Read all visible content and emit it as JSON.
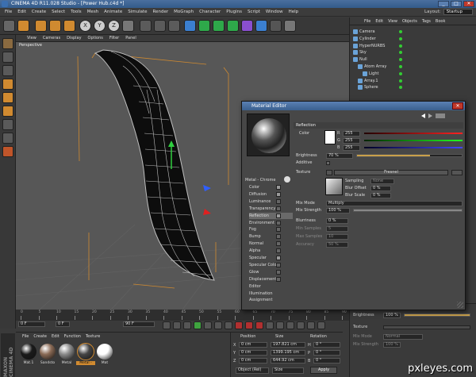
{
  "app": {
    "title": "CINEMA 4D R11.028 Studio - [Power Hub.c4d *]"
  },
  "menu": [
    "File",
    "Edit",
    "Create",
    "Select",
    "Tools",
    "Mesh",
    "Animate",
    "Simulate",
    "Render",
    "MoGraph",
    "Character",
    "Plugins",
    "Script",
    "Window",
    "Help"
  ],
  "layout": {
    "label": "Layout:",
    "value": "Startup"
  },
  "toolbar": {
    "icons": [
      "undo-icon",
      "select-icon",
      "move-icon",
      "scale-icon",
      "rotate-icon",
      "x-axis-icon",
      "y-axis-icon",
      "z-axis-icon",
      "coord-icon",
      "render-view-icon",
      "render-icon",
      "render-settings-icon",
      "cube-icon",
      "pen-icon",
      "subdivision-icon",
      "array-icon",
      "deformer-icon",
      "scene-icon",
      "camera-icon",
      "light-icon"
    ],
    "axes": [
      "X",
      "Y",
      "Z"
    ]
  },
  "viewport": {
    "menu": [
      "View",
      "Cameras",
      "Display",
      "Options",
      "Filter",
      "Panel"
    ],
    "label": "Perspective"
  },
  "objects": {
    "menu": [
      "File",
      "Edit",
      "View",
      "Objects",
      "Tags",
      "Book"
    ],
    "items": [
      {
        "name": "Camera",
        "indent": 0
      },
      {
        "name": "Cylinder",
        "indent": 0
      },
      {
        "name": "HyperNURBS",
        "indent": 0
      },
      {
        "name": "Sky",
        "indent": 0
      },
      {
        "name": "Null",
        "indent": 0
      },
      {
        "name": "Atom Array",
        "indent": 1
      },
      {
        "name": "Light",
        "indent": 2
      },
      {
        "name": "Array.1",
        "indent": 1
      },
      {
        "name": "Sphere",
        "indent": 1
      }
    ]
  },
  "material_editor": {
    "title": "Material Editor",
    "material_name": "Metal - Chrome",
    "channels": [
      {
        "name": "Color",
        "on": true
      },
      {
        "name": "Diffusion",
        "on": true
      },
      {
        "name": "Luminance",
        "on": false
      },
      {
        "name": "Transparency",
        "on": false
      },
      {
        "name": "Reflection",
        "on": true
      },
      {
        "name": "Environment",
        "on": false
      },
      {
        "name": "Fog",
        "on": false
      },
      {
        "name": "Bump",
        "on": false
      },
      {
        "name": "Normal",
        "on": false
      },
      {
        "name": "Alpha",
        "on": false
      },
      {
        "name": "Specular",
        "on": true
      },
      {
        "name": "Specular Color",
        "on": false
      },
      {
        "name": "Glow",
        "on": false
      },
      {
        "name": "Displacement",
        "on": false
      },
      {
        "name": "Editor",
        "on": null
      },
      {
        "name": "Illumination",
        "on": null
      },
      {
        "name": "Assignment",
        "on": null
      }
    ],
    "section": "Reflection",
    "color": {
      "label": "Color",
      "r_label": "R",
      "g_label": "G",
      "b_label": "B",
      "r": "255",
      "g": "255",
      "b": "255"
    },
    "brightness": {
      "label": "Brightness",
      "value": "70 %",
      "fraction": 0.7
    },
    "additive": {
      "label": "Additive"
    },
    "texture": {
      "label": "Texture",
      "value": "Fresnel"
    },
    "sampling": {
      "label": "Sampling",
      "value": "None"
    },
    "blur_offset": {
      "label": "Blur Offset",
      "value": "0 %"
    },
    "blur_scale": {
      "label": "Blur Scale",
      "value": "0 %"
    },
    "mix_mode": {
      "label": "Mix Mode",
      "value": "Multiply"
    },
    "mix_strength": {
      "label": "Mix Strength",
      "value": "100 %",
      "fraction": 1.0
    },
    "blurriness": {
      "label": "Blurriness",
      "value": "0 %"
    },
    "min_samples": {
      "label": "Min Samples",
      "value": "5"
    },
    "max_samples": {
      "label": "Max Samples",
      "value": "10"
    },
    "accuracy": {
      "label": "Accuracy",
      "value": "50 %"
    }
  },
  "timeline": {
    "ticks": [
      "0",
      "5",
      "10",
      "15",
      "20",
      "25",
      "30",
      "35",
      "40",
      "45",
      "50",
      "55",
      "60",
      "65",
      "70",
      "75",
      "80",
      "85",
      "90"
    ],
    "start": "0 F",
    "current": "0 F",
    "end": "90 F"
  },
  "material_manager": {
    "menu": [
      "File",
      "Create",
      "Edit",
      "Function",
      "Texture"
    ],
    "materials": [
      {
        "name": "Mat.1",
        "color": "#1a1a1a"
      },
      {
        "name": "Sandsto",
        "color": "#8a6a55"
      },
      {
        "name": "Metal",
        "color": "#8a8a8a"
      },
      {
        "name": "Metal -",
        "color": "#444444",
        "selected": true
      },
      {
        "name": "Mat",
        "color": "#ffffff"
      }
    ]
  },
  "coordinates": {
    "headers": [
      "Position",
      "Size",
      "Rotation"
    ],
    "rows": [
      {
        "axis": "X",
        "pos": "0 cm",
        "size": "197.821 cm",
        "rot_axis": "H",
        "rot": "0 °"
      },
      {
        "axis": "Y",
        "pos": "0 cm",
        "size": "1399.195 cm",
        "rot_axis": "P",
        "rot": "0 °"
      },
      {
        "axis": "Z",
        "pos": "0 cm",
        "size": "644.92 cm",
        "rot_axis": "B",
        "rot": "0 °"
      }
    ],
    "mode": "Object (Rel)",
    "size_mode": "Size",
    "apply": "Apply"
  },
  "attributes": {
    "brightness": {
      "label": "Brightness",
      "value": "100 %",
      "fraction": 1.0
    },
    "texture": {
      "label": "Texture"
    },
    "mix_mode": {
      "label": "Mix Mode",
      "value": "Normal"
    },
    "mix_strength": {
      "label": "Mix Strength",
      "value": "100 %"
    }
  },
  "branding": {
    "maxon": "MAXON CINEMA 4D",
    "watermark": "pxleyes.com"
  }
}
